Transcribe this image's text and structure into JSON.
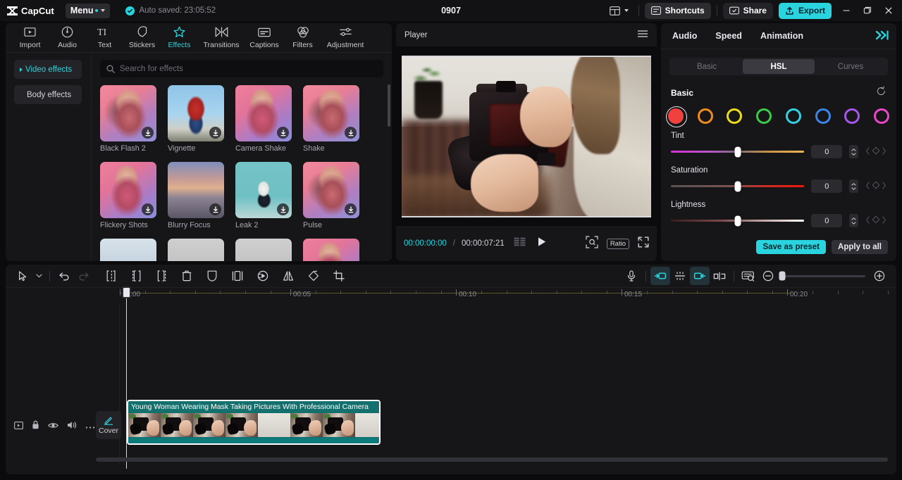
{
  "titlebar": {
    "app_name": "CapCut",
    "menu_label": "Menu",
    "autosave_text": "Auto saved: 23:05:52",
    "project_title": "0907",
    "shortcuts_label": "Shortcuts",
    "share_label": "Share",
    "export_label": "Export",
    "minimize_icon": "minimize-icon",
    "maximize_icon": "maximize-icon",
    "close_icon": "close-icon",
    "layout_icon": "layout-icon"
  },
  "left_panel": {
    "tabs": [
      {
        "label": "Import",
        "icon": "import-icon",
        "active": false
      },
      {
        "label": "Audio",
        "icon": "audio-icon",
        "active": false
      },
      {
        "label": "Text",
        "icon": "text-icon",
        "active": false
      },
      {
        "label": "Stickers",
        "icon": "stickers-icon",
        "active": false
      },
      {
        "label": "Effects",
        "icon": "effects-icon",
        "active": true
      },
      {
        "label": "Transitions",
        "icon": "transitions-icon",
        "active": false
      },
      {
        "label": "Captions",
        "icon": "captions-icon",
        "active": false
      },
      {
        "label": "Filters",
        "icon": "filters-icon",
        "active": false
      },
      {
        "label": "Adjustment",
        "icon": "adjustment-icon",
        "active": false
      }
    ],
    "categories": [
      {
        "label": "Video effects",
        "active": true
      },
      {
        "label": "Body effects",
        "active": false
      }
    ],
    "search": {
      "placeholder": "Search for effects",
      "value": "",
      "icon": "search-icon"
    },
    "effects": [
      {
        "name": "Black Flash 2",
        "scene": "sc-girl"
      },
      {
        "name": "Vignette",
        "scene": "sc-boy"
      },
      {
        "name": "Camera Shake",
        "scene": "sc-girl2"
      },
      {
        "name": "Shake",
        "scene": "sc-girl"
      },
      {
        "name": "Flickery Shots",
        "scene": "sc-girl2"
      },
      {
        "name": "Blurry Focus",
        "scene": "sc-city"
      },
      {
        "name": "Leak 2",
        "scene": "sc-dance"
      },
      {
        "name": "Pulse",
        "scene": "sc-girl"
      },
      {
        "name": "",
        "scene": "sc-cloud"
      },
      {
        "name": "",
        "scene": "sc-grey"
      },
      {
        "name": "",
        "scene": "sc-grey"
      },
      {
        "name": "",
        "scene": "sc-girl2"
      }
    ]
  },
  "player": {
    "title": "Player",
    "menu_icon": "hamburger-icon",
    "current_time": "00:00:00:00",
    "time_separator": "/",
    "total_time": "00:00:07:21",
    "frames_icon": "frames-icon",
    "play_icon": "play-icon",
    "magnify_icon": "magnify-icon",
    "ratio_label": "Ratio",
    "fullscreen_icon": "fullscreen-icon"
  },
  "right_panel": {
    "tabs": [
      {
        "label": "Audio",
        "active": false
      },
      {
        "label": "Speed",
        "active": false
      },
      {
        "label": "Animation",
        "active": false
      }
    ],
    "collapse_icon": "double-chevron-right-icon",
    "segments": [
      {
        "label": "Basic",
        "active": false
      },
      {
        "label": "HSL",
        "active": true
      },
      {
        "label": "Curves",
        "active": false
      }
    ],
    "section_label": "Basic",
    "reset_icon": "reset-icon",
    "swatches": [
      {
        "name": "red",
        "color": "#f0413f",
        "selected": true
      },
      {
        "name": "orange",
        "color": "#ef8b1f",
        "selected": false
      },
      {
        "name": "yellow",
        "color": "#ecdb19",
        "selected": false
      },
      {
        "name": "green",
        "color": "#3ccb46",
        "selected": false
      },
      {
        "name": "cyan",
        "color": "#31d3e2",
        "selected": false
      },
      {
        "name": "blue",
        "color": "#3a86e8",
        "selected": false
      },
      {
        "name": "purple",
        "color": "#a457e9",
        "selected": false
      },
      {
        "name": "magenta",
        "color": "#ea47c8",
        "selected": false
      }
    ],
    "sliders": [
      {
        "label": "Tint",
        "value": "0",
        "position": 50,
        "gradient": "linear-gradient(90deg,#d62fd6 0%,#b45abf 30%,#7c6b7a 50%,#c4914a 72%,#eeb454 100%)"
      },
      {
        "label": "Saturation",
        "value": "0",
        "position": 50,
        "gradient": "linear-gradient(90deg,#5a5252 0%,#7d5252 45%,#d12a22 72%,#f0170a 100%)"
      },
      {
        "label": "Lightness",
        "value": "0",
        "position": 50,
        "gradient": "linear-gradient(90deg,#3a1c1e 0%,#7b4a4c 38%,#c2a9a8 70%,#ffffff 100%)"
      }
    ],
    "save_preset_label": "Save as preset",
    "apply_all_label": "Apply to all"
  },
  "timeline": {
    "toolbar_left": [
      {
        "name": "select-tool-icon"
      },
      {
        "name": "chevron-down-icon"
      },
      {
        "name": "undo-icon"
      },
      {
        "name": "redo-icon"
      },
      {
        "name": "split-icon"
      },
      {
        "name": "trim-left-icon"
      },
      {
        "name": "trim-right-icon"
      },
      {
        "name": "delete-icon"
      },
      {
        "name": "mask-icon"
      },
      {
        "name": "freeze-frame-icon"
      },
      {
        "name": "speed-icon"
      },
      {
        "name": "mirror-icon"
      },
      {
        "name": "rotate-icon"
      },
      {
        "name": "crop-icon"
      }
    ],
    "toolbar_right": [
      {
        "name": "microphone-icon",
        "on": false
      },
      {
        "name": "snap-left-icon",
        "on": true
      },
      {
        "name": "auto-adjust-icon",
        "on": false
      },
      {
        "name": "link-icon",
        "on": true
      },
      {
        "name": "adsorb-icon",
        "on": false
      },
      {
        "name": "thumbnail-zoom-icon",
        "on": false
      },
      {
        "name": "zoom-out-icon",
        "on": false
      },
      {
        "name": "zoom-in-icon",
        "on": false
      }
    ],
    "ruler_labels": [
      "00:00",
      "00:05",
      "00:10",
      "00:15",
      "00:20"
    ],
    "track_head_icons": [
      {
        "name": "video-track-icon"
      },
      {
        "name": "lock-icon"
      },
      {
        "name": "eye-icon"
      },
      {
        "name": "speaker-icon"
      },
      {
        "name": "more-icon"
      }
    ],
    "cover_label": "Cover",
    "cover_icon": "pencil-icon",
    "clip": {
      "title": "Young Woman Wearing Mask Taking Pictures With Professional Camera",
      "color": "#0f7a7a"
    },
    "playhead_time": "00:00"
  }
}
